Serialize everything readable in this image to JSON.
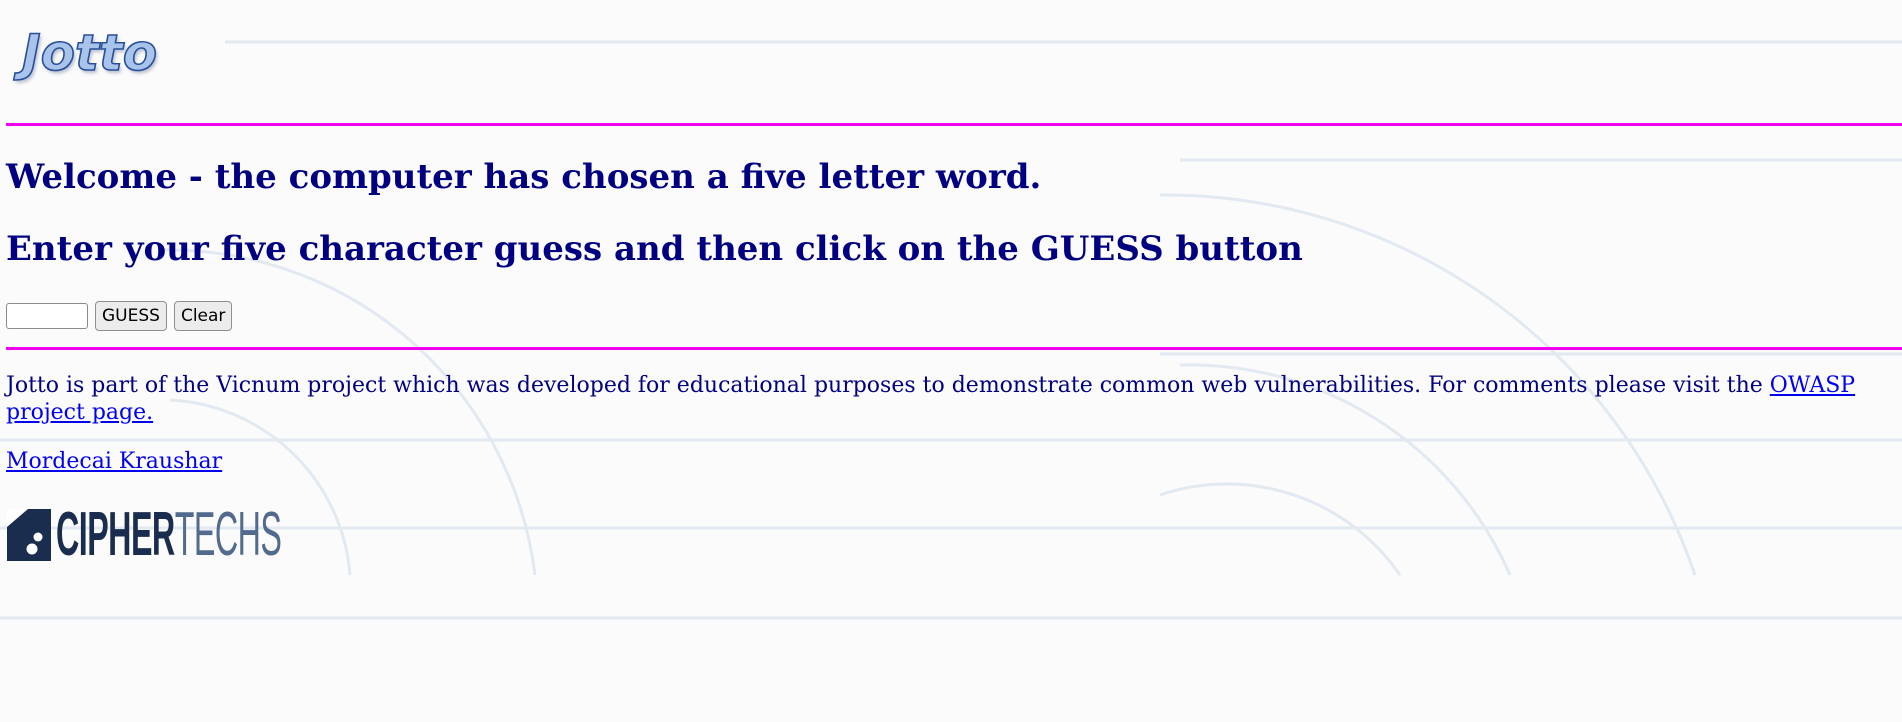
{
  "header": {
    "logo_text": "Jotto"
  },
  "main": {
    "welcome_heading": "Welcome - the computer has chosen a five letter word.",
    "instruction_heading": "Enter your five character guess and then click on the GUESS button",
    "guess_input": {
      "value": "",
      "placeholder": ""
    },
    "guess_button_label": "GUESS",
    "clear_button_label": "Clear"
  },
  "footer": {
    "info_text": "Jotto is part of the Vicnum project which was developed for educational purposes to demonstrate common web vulnerabilities. For comments please visit the ",
    "owasp_link_text": "OWASP project page.",
    "author_link_text": "Mordecai Kraushar",
    "company_logo": {
      "bold": "CIPHER",
      "light": "TECHS"
    }
  },
  "colors": {
    "divider": "#f000f0",
    "heading": "#000080",
    "link": "#0000ee",
    "background": "#fbfbfc"
  }
}
